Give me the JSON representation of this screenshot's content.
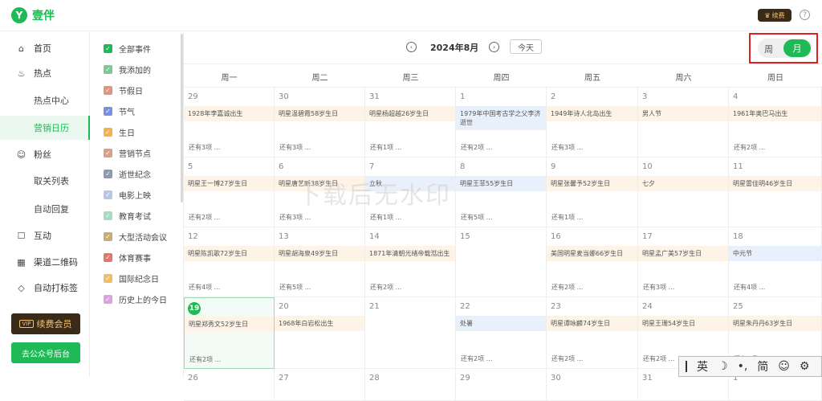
{
  "app": {
    "name": "壹伴",
    "logo_letter": "Y",
    "vip_chip": "续费",
    "help": "?"
  },
  "sidebar": {
    "items": [
      {
        "label": "首页",
        "icon": "home-icon",
        "glyph": "⌂"
      },
      {
        "label": "热点",
        "icon": "flame-icon",
        "glyph": "♨"
      },
      {
        "label": "热点中心",
        "sub": true
      },
      {
        "label": "营销日历",
        "sub": true,
        "active": true
      },
      {
        "label": "粉丝",
        "icon": "user-icon",
        "glyph": "☺"
      },
      {
        "label": "取关列表",
        "sub": true
      },
      {
        "label": "自动回复",
        "sub": true
      },
      {
        "label": "互动",
        "icon": "chat-icon",
        "glyph": "☐"
      },
      {
        "label": "渠道二维码",
        "icon": "qrcode-icon",
        "glyph": "▦"
      },
      {
        "label": "自动打标签",
        "icon": "tag-icon",
        "glyph": "◇"
      }
    ],
    "renew_button": "续费会员",
    "renew_badge": "VIP",
    "mp_button": "去公众号后台"
  },
  "categories": [
    {
      "label": "全部事件",
      "color": "#1fb955"
    },
    {
      "label": "我添加的",
      "color": "#7ec98f"
    },
    {
      "label": "节假日",
      "color": "#e3947a"
    },
    {
      "label": "节气",
      "color": "#7b8fe0"
    },
    {
      "label": "生日",
      "color": "#f1b24f"
    },
    {
      "label": "营销节点",
      "color": "#d9a08a"
    },
    {
      "label": "逝世纪念",
      "color": "#8e9aae"
    },
    {
      "label": "电影上映",
      "color": "#b9c6e6"
    },
    {
      "label": "教育考试",
      "color": "#a7dcc4"
    },
    {
      "label": "大型活动会议",
      "color": "#c6ae72"
    },
    {
      "label": "体育赛事",
      "color": "#e2776a"
    },
    {
      "label": "国际纪念日",
      "color": "#f0be6a"
    },
    {
      "label": "历史上的今日",
      "color": "#d9a4df"
    }
  ],
  "calendar": {
    "month_title": "2024年8月",
    "prev": "‹",
    "next": "›",
    "today_button": "今天",
    "view_week": "周",
    "view_month": "月",
    "weekdays": [
      "周一",
      "周二",
      "周三",
      "周四",
      "周五",
      "周六",
      "周日"
    ],
    "weeks": [
      [
        {
          "day": "29",
          "event": "1928年李嘉诚出生",
          "more": "还有3项 ..."
        },
        {
          "day": "30",
          "event": "明星温碧霞58岁生日",
          "more": "还有3项 ..."
        },
        {
          "day": "31",
          "event": "明星杨超越26岁生日",
          "more": "还有1项 ..."
        },
        {
          "day": "1",
          "event": "1979年中国考古学之父李济逝世",
          "type": "b",
          "more": "还有2项 ..."
        },
        {
          "day": "2",
          "event": "1949年诗人北岛出生",
          "more": "还有3项 ..."
        },
        {
          "day": "3",
          "event": "男人节",
          "more": ""
        },
        {
          "day": "4",
          "event": "1961年奥巴马出生",
          "more": "还有2项 ..."
        }
      ],
      [
        {
          "day": "5",
          "event": "明星王一博27岁生日",
          "more": "还有2项 ..."
        },
        {
          "day": "6",
          "event": "明星唐艺昕38岁生日",
          "more": "还有3项 ..."
        },
        {
          "day": "7",
          "event": "立秋",
          "type": "b",
          "more": "还有1项 ..."
        },
        {
          "day": "8",
          "event": "明星王菲55岁生日",
          "type": "b",
          "more": "还有5项 ..."
        },
        {
          "day": "9",
          "event": "明星张馨予52岁生日",
          "more": "还有1项 ..."
        },
        {
          "day": "10",
          "event": "七夕",
          "more": ""
        },
        {
          "day": "11",
          "event": "明星雷佳明46岁生日",
          "more": ""
        }
      ],
      [
        {
          "day": "12",
          "event": "明星陈凯歌72岁生日",
          "more": "还有4项 ..."
        },
        {
          "day": "13",
          "event": "明星胡海泉49岁生日",
          "more": "还有5项 ..."
        },
        {
          "day": "14",
          "event": "1871年清朝光绪帝载湉出生",
          "more": "还有2项 ..."
        },
        {
          "day": "15",
          "event": "",
          "more": ""
        },
        {
          "day": "16",
          "event": "美国明星麦当娜66岁生日",
          "more": "还有2项 ..."
        },
        {
          "day": "17",
          "event": "明星孟广美57岁生日",
          "more": "还有3项 ..."
        },
        {
          "day": "18",
          "event": "中元节",
          "type": "b",
          "more": "还有4项 ..."
        }
      ],
      [
        {
          "day": "19",
          "event": "明星郑秀文52岁生日",
          "today": true,
          "more": "还有2项 ..."
        },
        {
          "day": "20",
          "event": "1968年白岩松出生",
          "more": ""
        },
        {
          "day": "21",
          "event": "",
          "more": ""
        },
        {
          "day": "22",
          "event": "处暑",
          "type": "b",
          "more": "还有2项 ..."
        },
        {
          "day": "23",
          "event": "明星谭咏麟74岁生日",
          "more": "还有2项 ..."
        },
        {
          "day": "24",
          "event": "明星王珊54岁生日",
          "more": "还有2项 ..."
        },
        {
          "day": "25",
          "event": "明星朱丹丹63岁生日",
          "more": "还有2项 ..."
        }
      ],
      [
        {
          "day": "26",
          "event": "",
          "more": ""
        },
        {
          "day": "27",
          "event": "",
          "more": ""
        },
        {
          "day": "28",
          "event": "",
          "more": ""
        },
        {
          "day": "29",
          "event": "",
          "more": ""
        },
        {
          "day": "30",
          "event": "",
          "more": ""
        },
        {
          "day": "31",
          "event": "",
          "more": ""
        },
        {
          "day": "1",
          "event": "",
          "more": ""
        }
      ]
    ]
  },
  "watermark": "下载后无水印",
  "ime": {
    "items": [
      "英",
      "☽",
      "•,",
      "简",
      "☺",
      "⚙"
    ]
  }
}
